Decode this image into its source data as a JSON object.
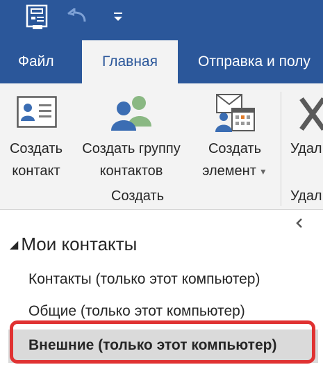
{
  "quick_access": {
    "icons": [
      "save-icon",
      "undo-icon",
      "customize-arrow-icon"
    ]
  },
  "tabs": {
    "file": "Файл",
    "home": "Главная",
    "send_receive": "Отправка и полу"
  },
  "ribbon": {
    "new_contact": {
      "line1": "Создать",
      "line2": "контакт"
    },
    "new_group": {
      "line1": "Создать группу",
      "line2": "контактов"
    },
    "new_item": {
      "line1": "Создать",
      "line2": "элемент"
    },
    "delete": {
      "line1": "Удал"
    },
    "group_create": "Создать",
    "group_delete": "Удал"
  },
  "nav": {
    "section": "Мои контакты",
    "items": [
      "Контакты (только этот компьютер)",
      "Общие (только этот компьютер)",
      "Внешние (только этот компьютер)"
    ],
    "selected_index": 2
  },
  "colors": {
    "title_bar": "#2b579a",
    "ribbon_bg": "#f3f3f3",
    "highlight": "#e03232",
    "selected_bg": "#dadada"
  }
}
